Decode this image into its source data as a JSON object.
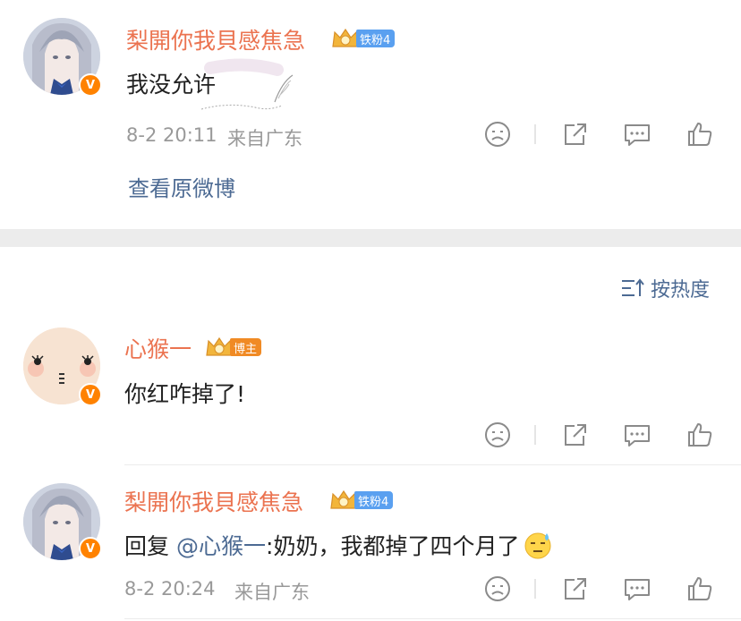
{
  "comments": [
    {
      "username": "梨開你我貝感焦急",
      "badge": "铁粉4",
      "text": "我没允许",
      "time": "8-2 20:11",
      "location": "来自广东",
      "view_original": "查看原微博"
    },
    {
      "username": "心猴一",
      "badge": "博主",
      "text": "你红咋掉了!"
    },
    {
      "username": "梨開你我貝感焦急",
      "badge": "铁粉4",
      "reply_prefix": "回复",
      "mention": "@心猴一",
      "text": ":奶奶，我都掉了四个月了",
      "time": "8-2 20:24",
      "location": "来自广东"
    }
  ],
  "sort": {
    "label": "按热度",
    "icon": "sort-icon"
  },
  "colors": {
    "username": "#eb7350",
    "link": "#4c6a93",
    "badge_fan": "#5aa0f0",
    "badge_host": "#f08a24",
    "verified": "#ff8200",
    "meta": "#999999"
  }
}
